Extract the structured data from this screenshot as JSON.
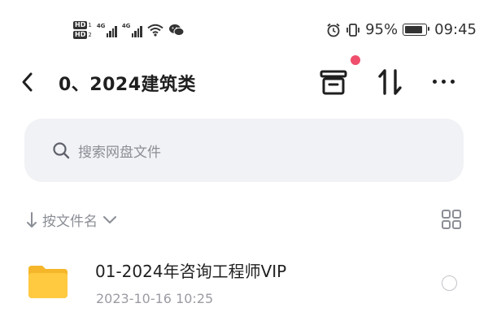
{
  "status_bar": {
    "sim1": "HD",
    "sim1_index": "1",
    "sim2": "HD",
    "sim2_index": "2",
    "network1": "4G",
    "network2": "4G",
    "battery_percent": "95%",
    "battery_level": 0.95,
    "time": "09:45",
    "icons": [
      "wifi-icon",
      "wechat-icon",
      "alarm-icon",
      "vibrate-icon",
      "battery-icon"
    ]
  },
  "header": {
    "title": "0、2024建筑类",
    "notification_dot_color": "#ef4f6c"
  },
  "search": {
    "placeholder": "搜索网盘文件"
  },
  "sort": {
    "label": "按文件名"
  },
  "files": [
    {
      "name": "01-2024年咨询工程师VIP",
      "date": "2023-10-16  10:25",
      "icon": "folder-icon",
      "icon_color": "#ffc940"
    }
  ]
}
